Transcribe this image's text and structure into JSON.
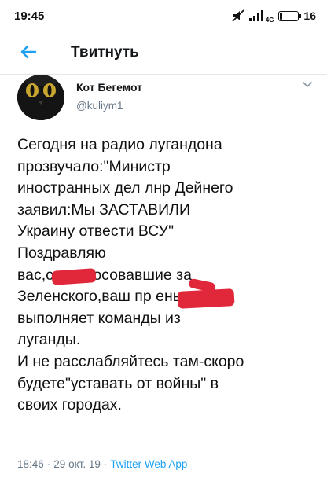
{
  "status_bar": {
    "time": "19:45",
    "network": "4G",
    "battery": "16",
    "battery_level": 0.16
  },
  "app_bar": {
    "title": "Твитнуть",
    "back_icon": "arrow-left-icon"
  },
  "tweet": {
    "author_name": "Кот Бегемот",
    "author_handle": "@kuliym1",
    "text": "Сегодня на радио лугандона\nпрозвучало:\"Министр\nиностранных дел лнр Дейнего\nзаявил:Мы ЗАСТАВИЛИ\nУкраину отвести ВСУ\"\nПоздравляю\nвас,с   и,голосовавшие за\nЗеленского,ваш пр        ень\nвыполняет команды из\nлуганды.\nИ не расслабляйтесь там-скоро\nбудете\"уставать от войны\" в\nсвоих городах.",
    "time": "18:46",
    "separator": "·",
    "date": "29 окт. 19",
    "source": "Twitter Web App"
  },
  "colors": {
    "accent": "#1da1f2",
    "secondary_text": "#657786",
    "redaction": "#e0283a"
  }
}
